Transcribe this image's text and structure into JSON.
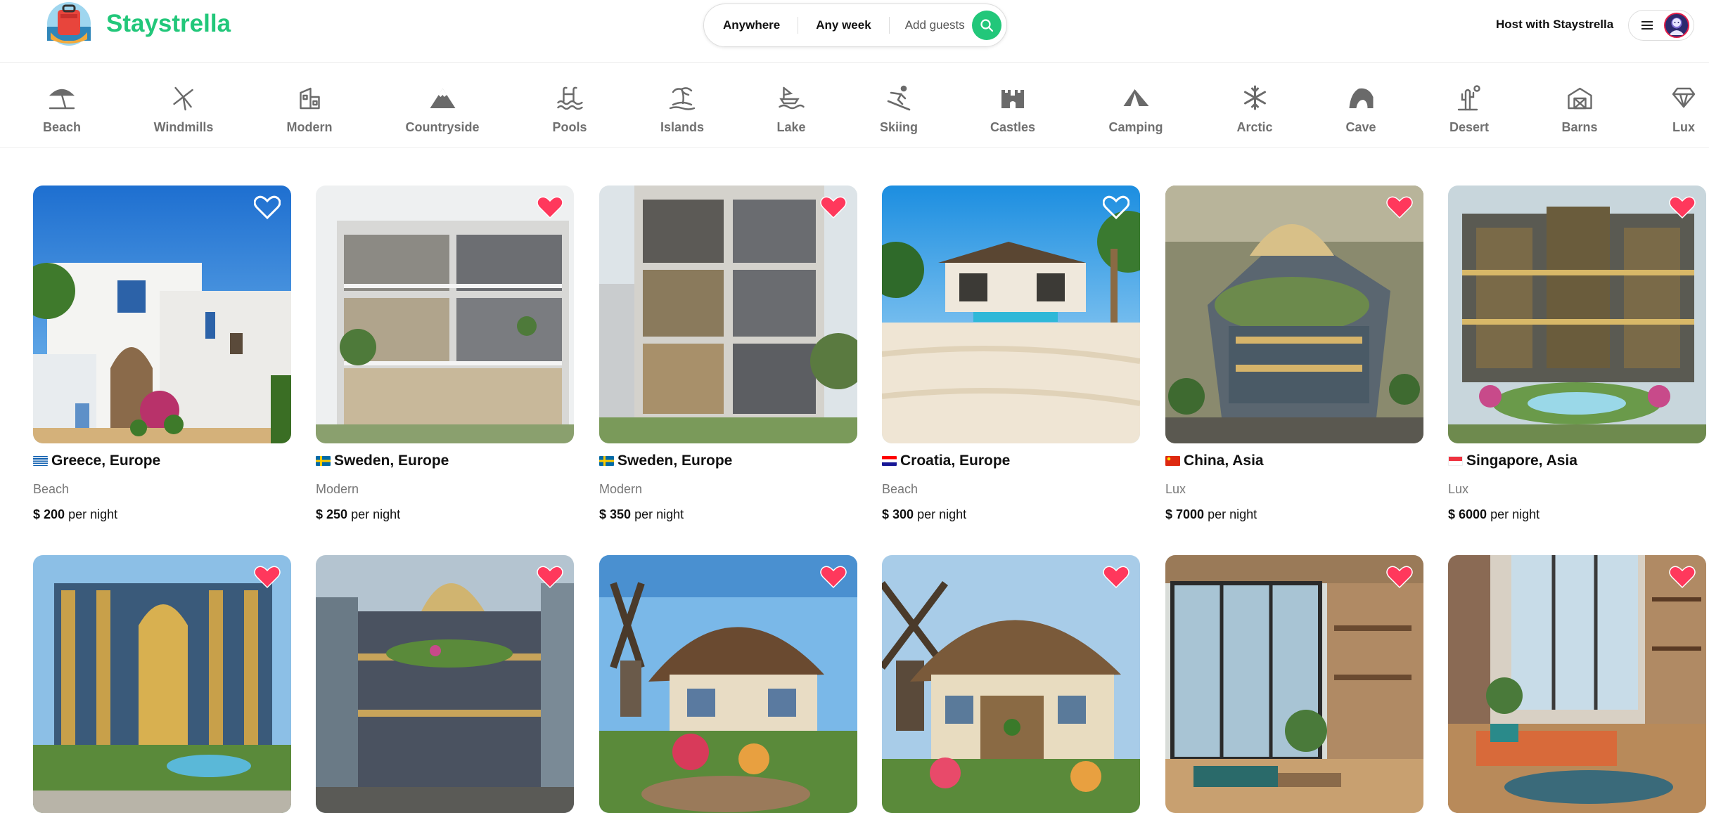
{
  "header": {
    "brand": "Staystrella",
    "search": {
      "where": "Anywhere",
      "when": "Any week",
      "guests": "Add guests"
    },
    "host_label": "Host with Staystrella"
  },
  "categories": [
    {
      "label": "Beach",
      "icon": "beach-umbrella-icon"
    },
    {
      "label": "Windmills",
      "icon": "windmill-icon"
    },
    {
      "label": "Modern",
      "icon": "modern-house-icon"
    },
    {
      "label": "Countryside",
      "icon": "mountain-icon"
    },
    {
      "label": "Pools",
      "icon": "pool-icon"
    },
    {
      "label": "Islands",
      "icon": "island-palm-icon"
    },
    {
      "label": "Lake",
      "icon": "lake-boat-icon"
    },
    {
      "label": "Skiing",
      "icon": "skiing-icon"
    },
    {
      "label": "Castles",
      "icon": "castle-icon"
    },
    {
      "label": "Camping",
      "icon": "tent-icon"
    },
    {
      "label": "Arctic",
      "icon": "snowflake-icon"
    },
    {
      "label": "Cave",
      "icon": "cave-icon"
    },
    {
      "label": "Desert",
      "icon": "cactus-icon"
    },
    {
      "label": "Barns",
      "icon": "barn-icon"
    },
    {
      "label": "Lux",
      "icon": "diamond-icon"
    }
  ],
  "listings": [
    {
      "location": "Greece, Europe",
      "category": "Beach",
      "price": "$ 200",
      "per": "per night",
      "favorited": false,
      "flag": "greece"
    },
    {
      "location": "Sweden, Europe",
      "category": "Modern",
      "price": "$ 250",
      "per": "per night",
      "favorited": true,
      "flag": "sweden"
    },
    {
      "location": "Sweden, Europe",
      "category": "Modern",
      "price": "$ 350",
      "per": "per night",
      "favorited": true,
      "flag": "sweden"
    },
    {
      "location": "Croatia, Europe",
      "category": "Beach",
      "price": "$ 300",
      "per": "per night",
      "favorited": false,
      "flag": "croatia"
    },
    {
      "location": "China, Asia",
      "category": "Lux",
      "price": "$ 7000",
      "per": "per night",
      "favorited": true,
      "flag": "china"
    },
    {
      "location": "Singapore, Asia",
      "category": "Lux",
      "price": "$ 6000",
      "per": "per night",
      "favorited": true,
      "flag": "singapore"
    },
    {
      "favorited": true
    },
    {
      "favorited": true
    },
    {
      "favorited": true
    },
    {
      "favorited": true
    },
    {
      "favorited": true
    },
    {
      "favorited": true
    }
  ],
  "colors": {
    "brand": "#22c77a",
    "heart": "#ff385c"
  }
}
